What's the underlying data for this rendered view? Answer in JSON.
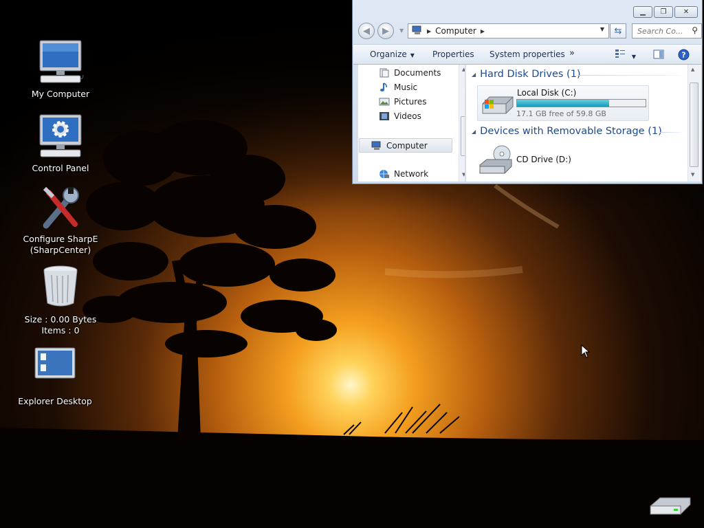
{
  "desktop": {
    "icons": [
      {
        "label": "My Computer"
      },
      {
        "label": "Control Panel"
      },
      {
        "label_line1": "Configure SharpE",
        "label_line2": "(SharpCenter)"
      },
      {
        "label_line1": "Size : 0.00 Bytes",
        "label_line2": "Items : 0"
      },
      {
        "label": "Explorer Desktop"
      }
    ]
  },
  "window": {
    "address": {
      "location": "Computer"
    },
    "search": {
      "placeholder": "Search Co..."
    },
    "toolbar": {
      "organize": "Organize",
      "properties": "Properties",
      "system_properties": "System properties",
      "more": "»"
    },
    "nav_pane": {
      "items": [
        {
          "label": "Documents",
          "icon": "documents-icon"
        },
        {
          "label": "Music",
          "icon": "music-icon"
        },
        {
          "label": "Pictures",
          "icon": "pictures-icon"
        },
        {
          "label": "Videos",
          "icon": "videos-icon"
        },
        {
          "label": "Computer",
          "icon": "computer-icon",
          "selected": true
        },
        {
          "label": "Network",
          "icon": "network-icon"
        }
      ]
    },
    "content": {
      "groups": [
        {
          "header": "Hard Disk Drives (1)",
          "drives": [
            {
              "name": "Local Disk (C:)",
              "free_text": "17.1 GB free of 59.8 GB",
              "used_fraction": 0.714
            }
          ]
        },
        {
          "header": "Devices with Removable Storage (1)",
          "drives": [
            {
              "name": "CD Drive (D:)"
            }
          ]
        }
      ]
    }
  },
  "colors": {
    "group_header": "#1e4a8c",
    "drive_bar": "#1a9ab5",
    "selection": "#dfe5ed"
  }
}
